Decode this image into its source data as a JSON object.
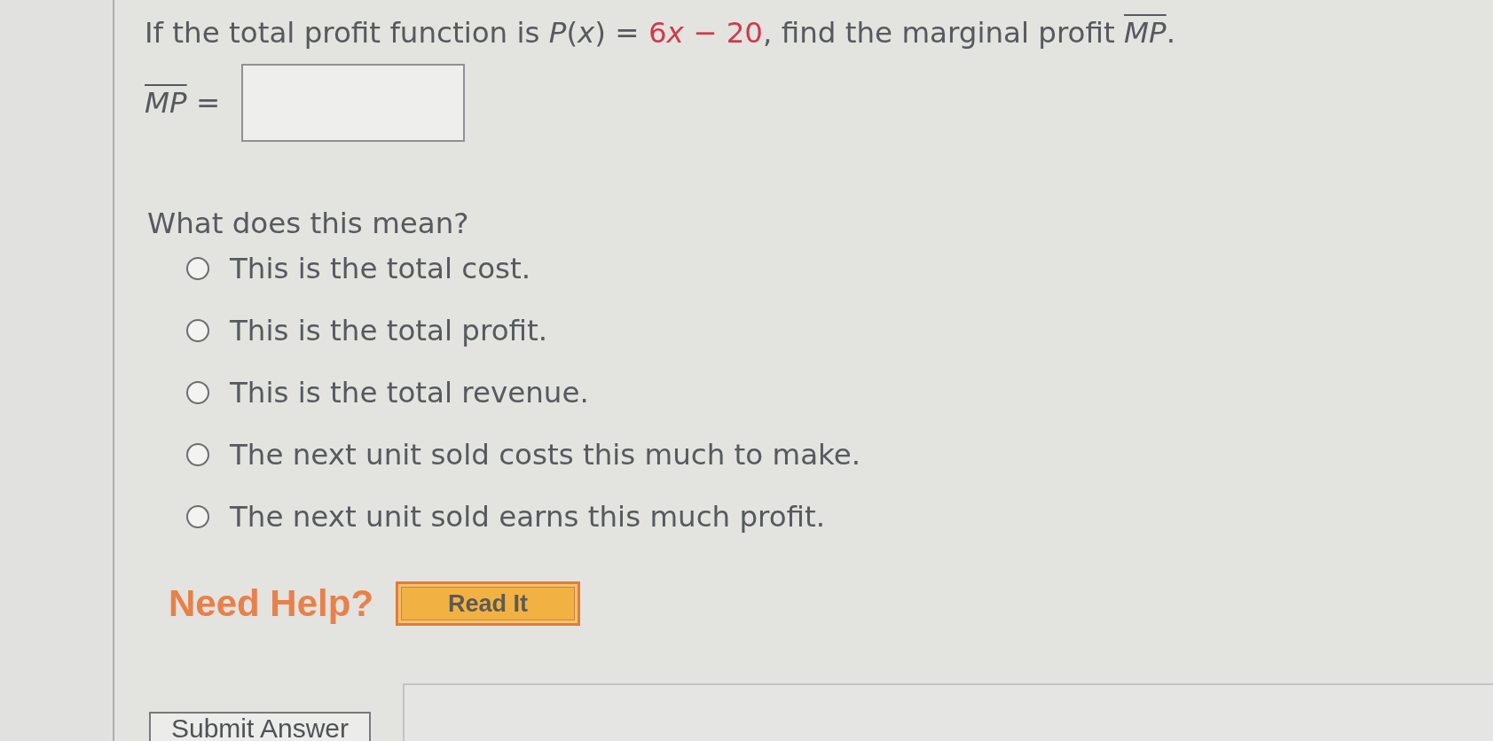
{
  "question": {
    "segments": [
      {
        "kind": "text",
        "text": "If the total profit function is *P*(*x*) = "
      },
      {
        "kind": "highlight",
        "text": "6"
      },
      {
        "kind": "highlight",
        "text": "*x*"
      },
      {
        "kind": "highlight",
        "text": " − 20"
      },
      {
        "kind": "text",
        "text": ", find the marginal profit "
      },
      {
        "kind": "overline",
        "text": "*MP*"
      },
      {
        "kind": "text",
        "text": "."
      }
    ]
  },
  "answer": {
    "label": [
      {
        "kind": "overline",
        "text": "*MP*"
      },
      {
        "kind": "text",
        "text": " ="
      }
    ]
  },
  "prompt": "What does this mean?",
  "options": [
    {
      "label": "This is the total cost.",
      "selected": false
    },
    {
      "label": "This is the total profit.",
      "selected": false
    },
    {
      "label": "This is the total revenue.",
      "selected": false
    },
    {
      "label": "The next unit sold costs this much to make.",
      "selected": false
    },
    {
      "label": "The next unit sold earns this much profit.",
      "selected": false
    }
  ],
  "help": {
    "label": "Need Help?",
    "buttons": [
      "Read It"
    ]
  },
  "submit_button": "Submit Answer"
}
